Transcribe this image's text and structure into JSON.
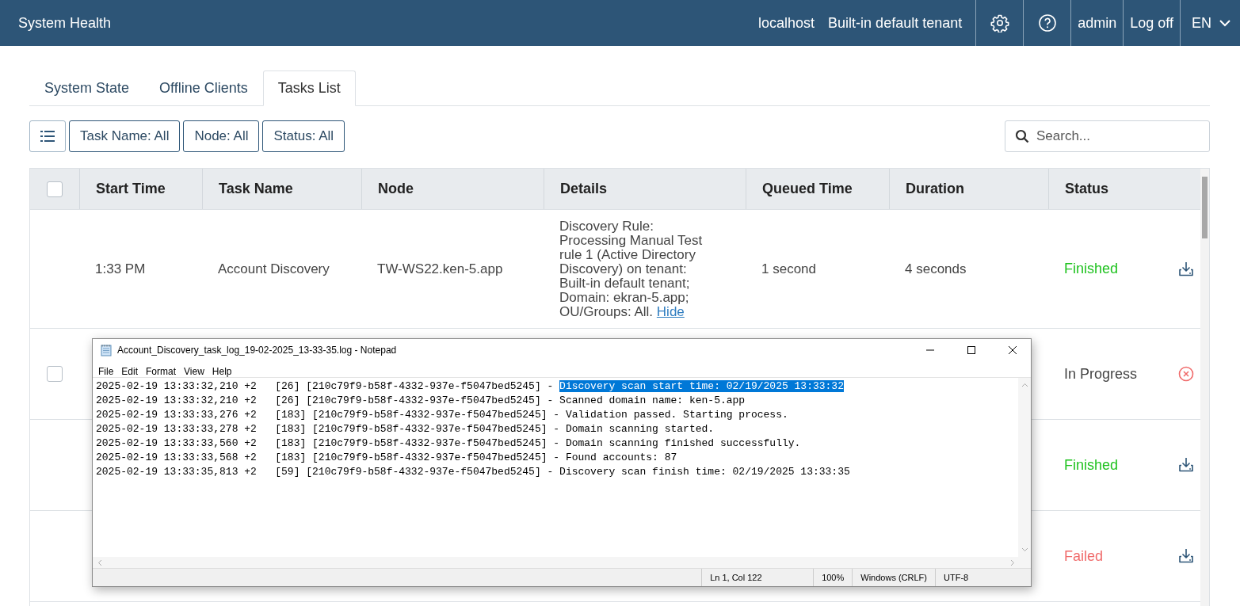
{
  "app_bar": {
    "title": "System Health",
    "host": "localhost",
    "tenant": "Built-in default tenant",
    "user": "admin",
    "logoff": "Log off",
    "language": "EN"
  },
  "tabs": [
    {
      "label": "System State",
      "selected": false
    },
    {
      "label": "Offline Clients",
      "selected": false
    },
    {
      "label": "Tasks List",
      "selected": true
    }
  ],
  "filters": [
    "Task Name: All",
    "Node: All",
    "Status: All"
  ],
  "search": {
    "placeholder": "Search..."
  },
  "table": {
    "header_checked": false,
    "columns": [
      "Start Time",
      "Task Name",
      "Node",
      "Details",
      "Queued Time",
      "Duration",
      "Status"
    ],
    "rows": [
      {
        "start_time": "1:33 PM",
        "task_name": "Account Discovery",
        "node": "TW-WS22.ken-5.app",
        "details": "Discovery Rule: Processing Manual Test rule 1 (Active Directory Discovery) on tenant: Built-in default tenant; Domain: ekran-5.app; OU/Groups: All.",
        "details_link": "Hide",
        "queued_time": "1 second",
        "duration": "4 seconds",
        "status": "Finished",
        "kind": "finished"
      },
      {
        "checked": false,
        "status": "In Progress",
        "kind": "in_progress"
      },
      {
        "status": "Finished",
        "kind": "finished"
      },
      {
        "status": "Failed",
        "kind": "failed"
      }
    ]
  },
  "notepad": {
    "title": "Account_Discovery_task_log_19-02-2025_13-33-35.log - Notepad",
    "menu": [
      "File",
      "Edit",
      "Format",
      "View",
      "Help"
    ],
    "lines": [
      {
        "prefix": "2025-02-19 13:33:32,210 +2   [26] [210c79f9-b58f-4332-937e-f5047bed5245] - ",
        "selected_text": "Discovery scan start time: 02/19/2025 13:33:32"
      },
      {
        "prefix": "2025-02-19 13:33:32,210 +2   [26] [210c79f9-b58f-4332-937e-f5047bed5245] - Scanned domain name: ken-5.app"
      },
      {
        "prefix": "2025-02-19 13:33:33,276 +2   [183] [210c79f9-b58f-4332-937e-f5047bed5245] - Validation passed. Starting process."
      },
      {
        "prefix": "2025-02-19 13:33:33,278 +2   [183] [210c79f9-b58f-4332-937e-f5047bed5245] - Domain scanning started."
      },
      {
        "prefix": "2025-02-19 13:33:33,560 +2   [183] [210c79f9-b58f-4332-937e-f5047bed5245] - Domain scanning finished successfully."
      },
      {
        "prefix": "2025-02-19 13:33:33,568 +2   [183] [210c79f9-b58f-4332-937e-f5047bed5245] - Found accounts: 87"
      },
      {
        "prefix": "2025-02-19 13:33:35,813 +2   [59] [210c79f9-b58f-4332-937e-f5047bed5245] - Discovery scan finish time: 02/19/2025 13:33:35"
      }
    ],
    "status_bar": [
      "Ln 1, Col 122",
      "100%",
      "Windows (CRLF)",
      "UTF-8"
    ]
  }
}
